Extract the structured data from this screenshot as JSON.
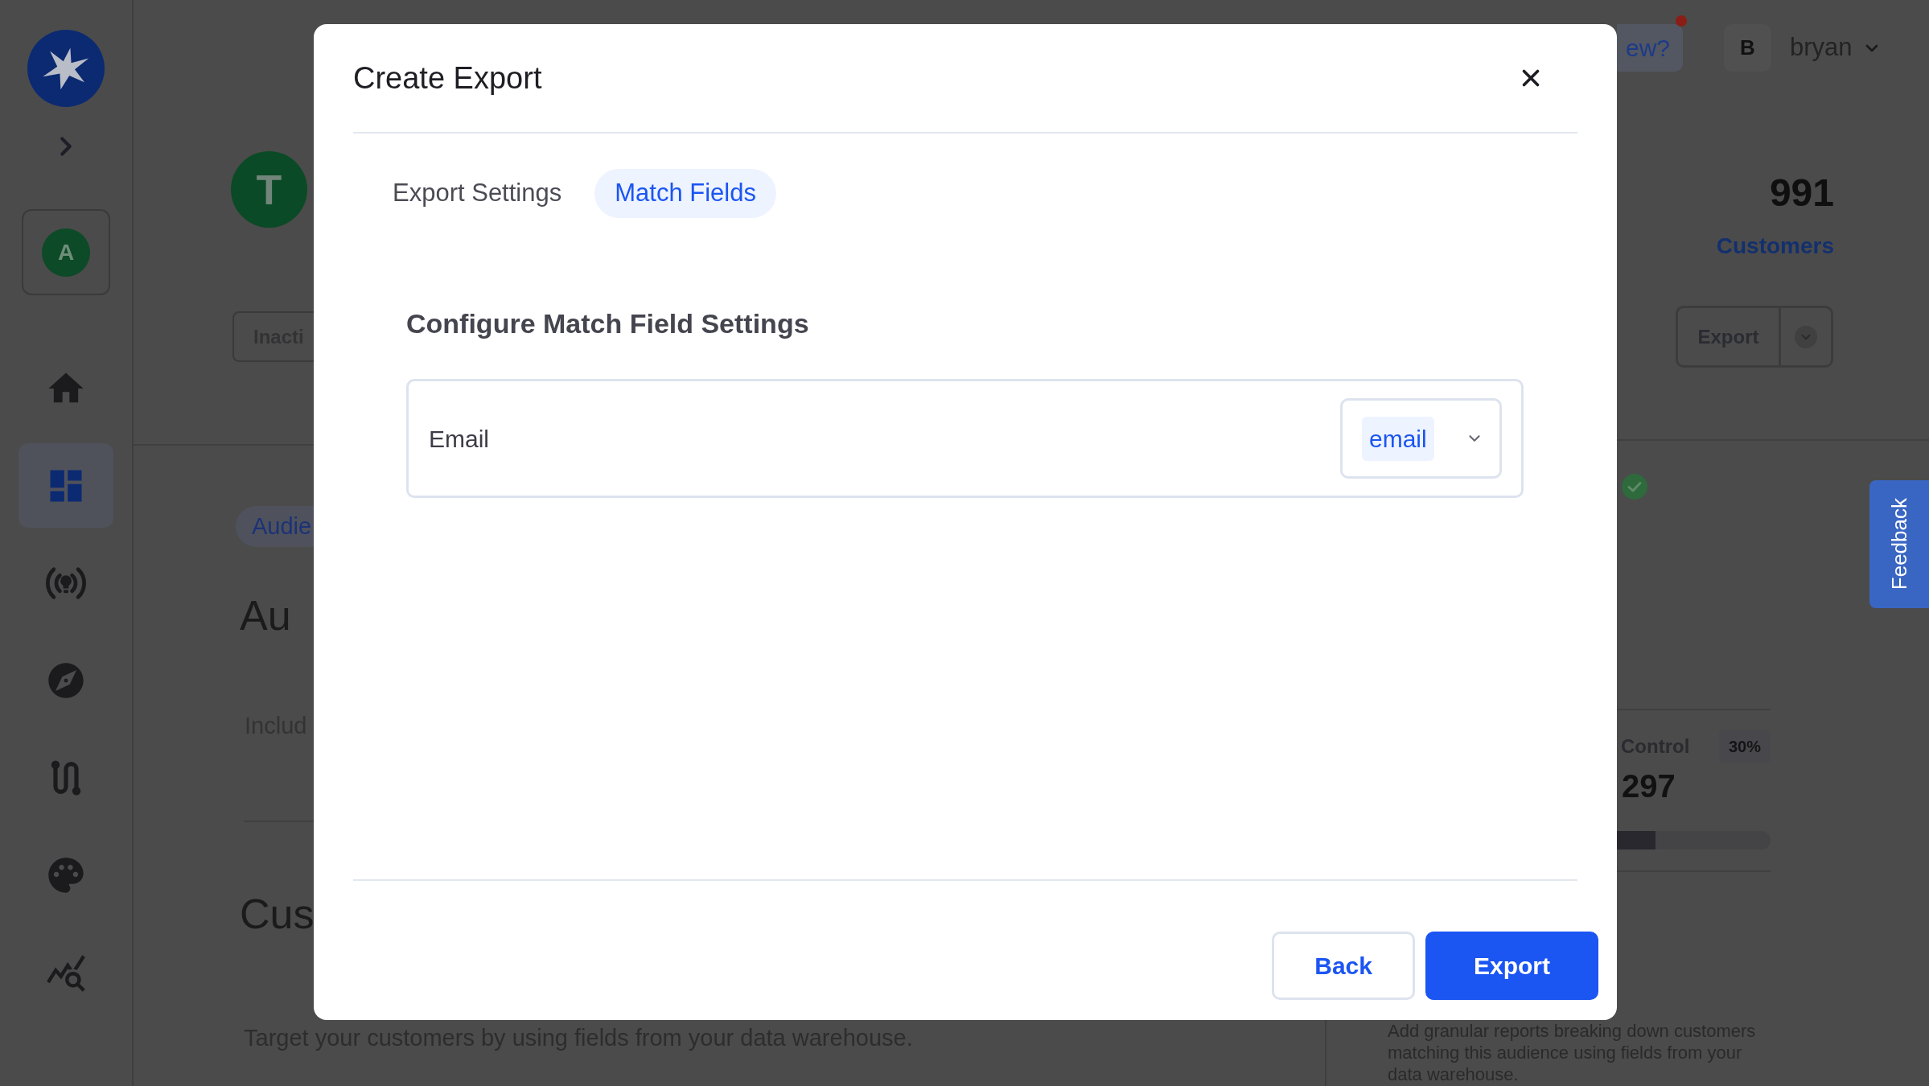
{
  "sidebar": {
    "account_initial": "A",
    "nav_items": [
      {
        "selected": false
      },
      {
        "selected": true
      },
      {
        "selected": false
      },
      {
        "selected": false
      },
      {
        "selected": false
      },
      {
        "selected": false
      },
      {
        "selected": false
      }
    ]
  },
  "top_bar": {
    "whats_new": {
      "label": "ew?",
      "unread": true
    },
    "user": {
      "initial": "B",
      "name": "bryan"
    }
  },
  "audience": {
    "avatar_initial": "T",
    "status_button": "Inacti",
    "type_badge": "Audie",
    "title": "Au",
    "description": "Includ",
    "section_title": "Cus",
    "section_description": "Target your customers by using fields from your data warehouse."
  },
  "summary": {
    "count": "991",
    "count_label": "Customers",
    "export_button": "Export"
  },
  "holdout": {
    "label": "Control",
    "share": "30%",
    "count": "297",
    "level": 0.25
  },
  "reports": {
    "description": "Add granular reports breaking down customers matching this audience using fields from your data warehouse."
  },
  "feedback_tab": {
    "label": "Feedback"
  },
  "modal": {
    "title": "Create Export",
    "tabs": [
      {
        "label": "Export Settings",
        "selected": false
      },
      {
        "label": "Match Fields",
        "selected": true
      }
    ],
    "section_title": "Configure Match Field Settings",
    "match_fields": [
      {
        "label": "Email",
        "value": "email"
      }
    ],
    "buttons": [
      {
        "label": "Back",
        "kind": "secondary"
      },
      {
        "label": "Export",
        "kind": "primary"
      }
    ]
  }
}
